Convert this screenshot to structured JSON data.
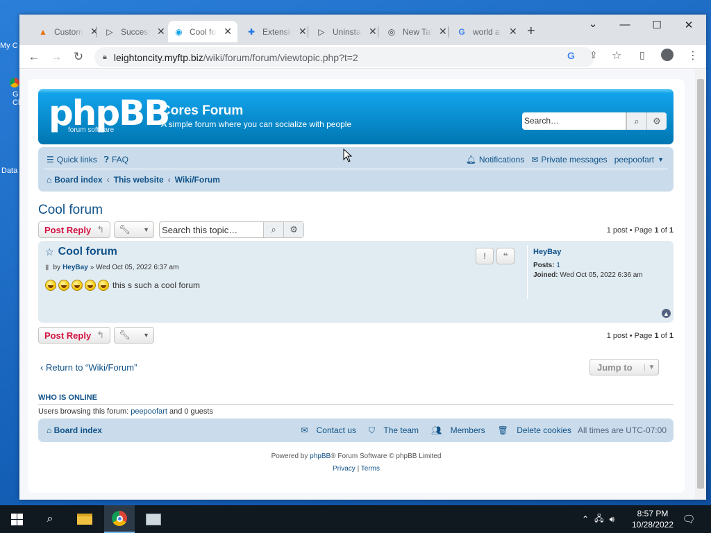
{
  "desktop": {
    "icons": [
      {
        "label": "My C"
      },
      {
        "label": "G Cl"
      },
      {
        "label": "Data"
      }
    ]
  },
  "browser": {
    "tabs": [
      {
        "title": "Custom",
        "icon": "chrome-app-icon"
      },
      {
        "title": "Success",
        "icon": "play-icon"
      },
      {
        "title": "Cool forum",
        "icon": "phpbb-favicon",
        "active": true
      },
      {
        "title": "Extensions",
        "icon": "puzzle-icon"
      },
      {
        "title": "Uninstall",
        "icon": "play-icon"
      },
      {
        "title": "New Tab",
        "icon": "chrome-icon"
      },
      {
        "title": "world a",
        "icon": "google-icon"
      }
    ],
    "new_tab": "+",
    "window_controls": {
      "minimize": "—",
      "maximize": "☐",
      "close": "✕",
      "dropdown": "⌄"
    },
    "url_host": "leightoncity.myftp.biz",
    "url_path": "/wiki/forum/forum/viewtopic.php?t=2"
  },
  "forum": {
    "logo_text": "phpBB",
    "logo_sub": "forum     software",
    "site_title": "Cores Forum",
    "site_desc": "A simple forum where you can socialize with people",
    "search_placeholder": "Search…",
    "nav": {
      "quick_links": "Quick links",
      "faq": "FAQ",
      "notifications": "Notifications",
      "private_messages": "Private messages",
      "username": "peepoofart"
    },
    "breadcrumbs": [
      "Board index",
      "This website",
      "Wiki/Forum"
    ],
    "topic_title": "Cool forum",
    "post_reply": "Post Reply",
    "topic_search_placeholder": "Search this topic…",
    "pagination": {
      "posts": "1 post",
      "page_label": "Page",
      "page": "1",
      "of": "of",
      "total": "1"
    },
    "post": {
      "title": "Cool forum",
      "by": "by",
      "author": "HeyBay",
      "date": "» Wed Oct 05, 2022 6:37 am",
      "emoji_count": 5,
      "text": "this s such a cool forum",
      "profile": {
        "username": "HeyBay",
        "posts_label": "Posts:",
        "posts": "1",
        "joined_label": "Joined:",
        "joined": "Wed Oct 05, 2022 6:36 am"
      }
    },
    "return_link": "Return to “Wiki/Forum”",
    "jump_to": "Jump to",
    "who_is_online": "Who is online",
    "who_text_prefix": "Users browsing this forum:",
    "who_user": "peepoofart",
    "who_text_suffix": "and 0 guests",
    "footer": {
      "board_index": "Board index",
      "contact": "Contact us",
      "team": "The team",
      "members": "Members",
      "delete_cookies": "Delete cookies",
      "timezone": "All times are UTC-07:00"
    },
    "powered": {
      "prefix": "Powered by",
      "link": "phpBB",
      "suffix": "® Forum Software © phpBB Limited"
    },
    "privacy": "Privacy",
    "terms": "Terms"
  },
  "taskbar": {
    "time": "8:57 PM",
    "date": "10/28/2022"
  },
  "colors": {
    "accent": "#105289",
    "header_blue": "#0076b1",
    "reply_red": "#d31141",
    "navbar_bg": "#cadceb",
    "post_bg": "#e1ebf2"
  }
}
